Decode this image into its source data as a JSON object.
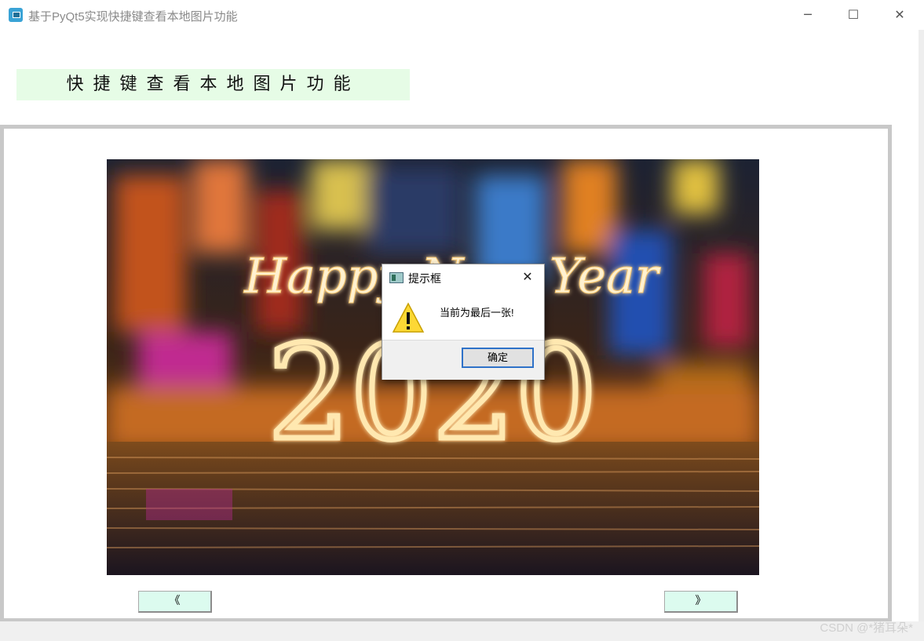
{
  "window": {
    "title": "基于PyQt5实现快捷键查看本地图片功能",
    "icon": "app-icon",
    "controls": {
      "minimize": "─",
      "maximize": "☐",
      "close": "✕"
    }
  },
  "heading": {
    "text": "快捷键查看本地图片功能",
    "background": "#e6fce6"
  },
  "image_viewer": {
    "photo_text": {
      "line1": "Happy New Year",
      "line2": "2020"
    }
  },
  "navigation": {
    "prev_label": "《",
    "next_label": "》",
    "button_color": "#dcfbef"
  },
  "dialog": {
    "title": "提示框",
    "close_glyph": "✕",
    "icon": "warning-icon",
    "message": "当前为最后一张!",
    "ok_label": "确定",
    "accent": "#2f72c8"
  },
  "watermark": "CSDN @*猪耳朵*"
}
